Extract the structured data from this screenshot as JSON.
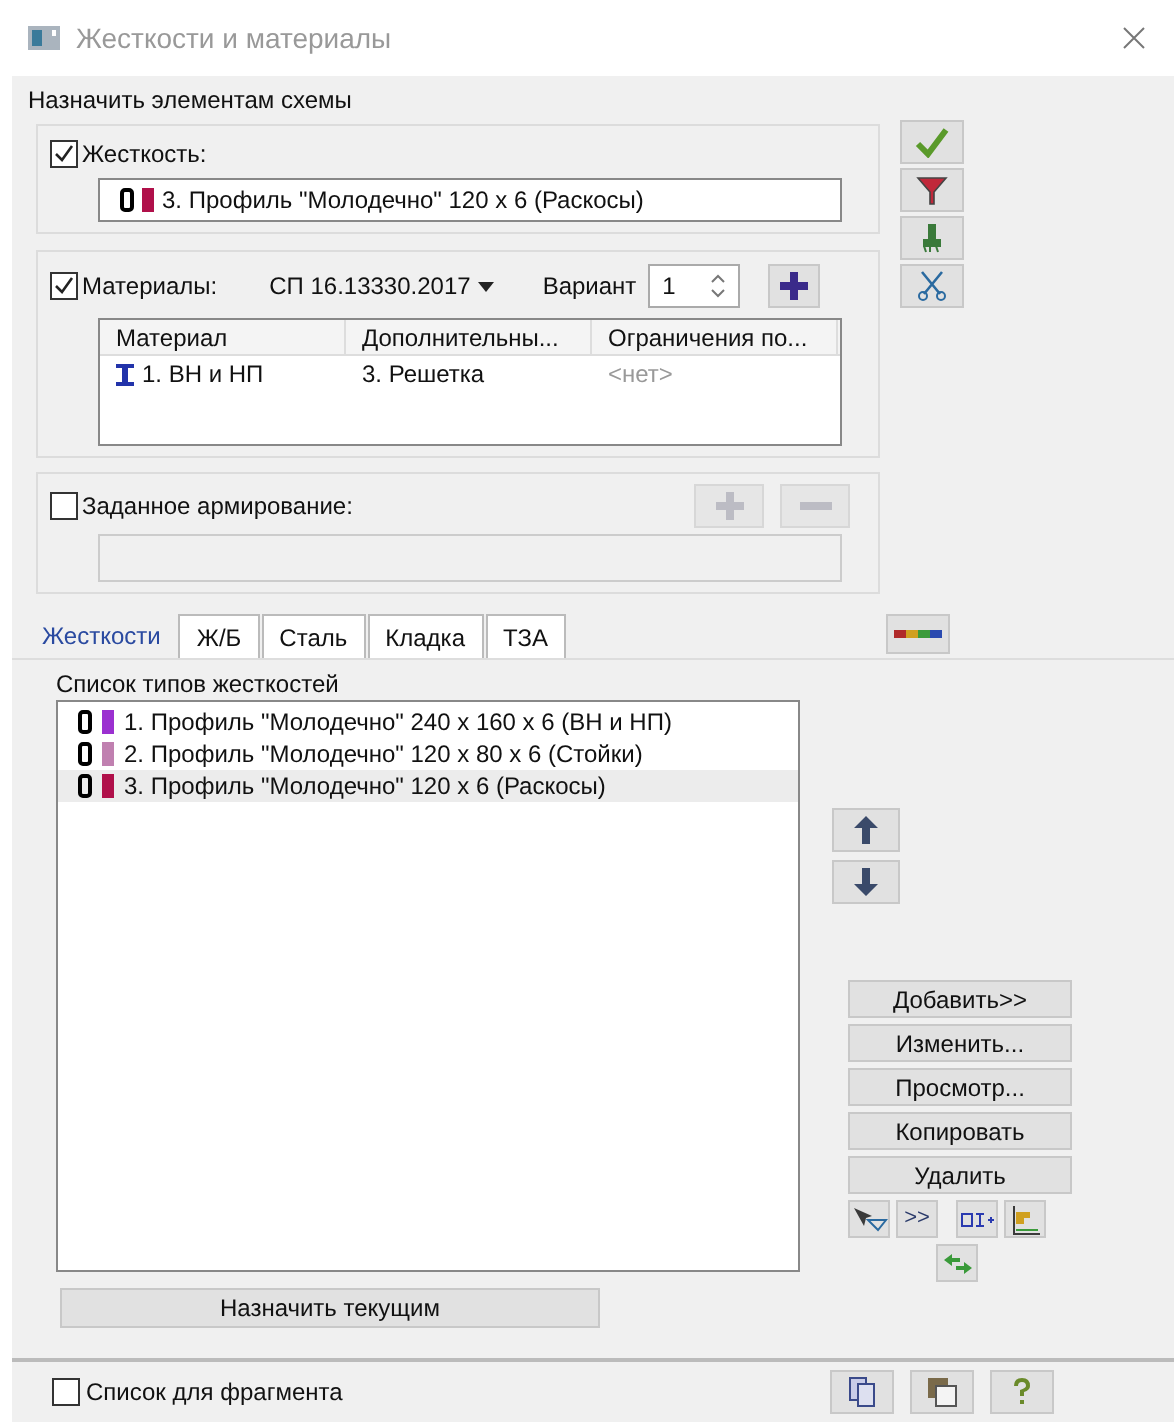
{
  "window": {
    "title": "Жесткости и материалы"
  },
  "assign_label": "Назначить элементам схемы",
  "stiffness": {
    "label": "Жесткость:",
    "checked": true,
    "value": "3. Профиль \"Молодечно\" 120 x 6 (Раскосы)",
    "color": "#b0104a"
  },
  "materials": {
    "label": "Материалы:",
    "checked": true,
    "standard": "СП 16.13330.2017",
    "variant_label": "Вариант",
    "variant": "1",
    "columns": [
      "Материал",
      "Дополнительны...",
      "Ограничения по..."
    ],
    "rows": [
      {
        "cells": [
          "1. ВН и НП",
          "3. Решетка",
          "<нет>"
        ]
      }
    ]
  },
  "reinforcement": {
    "label": "Заданное армирование:",
    "checked": false
  },
  "tabs": [
    {
      "label": "Жесткости",
      "selected": true
    },
    {
      "label": "Ж/Б",
      "selected": false
    },
    {
      "label": "Сталь",
      "selected": false
    },
    {
      "label": "Кладка",
      "selected": false
    },
    {
      "label": "ТЗА",
      "selected": false
    }
  ],
  "list": {
    "title": "Список типов жесткостей",
    "items": [
      {
        "text": "1. Профиль \"Молодечно\" 240 x 160 x 6 (ВН и НП)",
        "color": "#9b30d0",
        "selected": false
      },
      {
        "text": "2. Профиль \"Молодечно\" 120 x 80 x 6 (Стойки)",
        "color": "#c080b0",
        "selected": false
      },
      {
        "text": "3. Профиль \"Молодечно\" 120 x 6 (Раскосы)",
        "color": "#b0104a",
        "selected": true
      }
    ]
  },
  "action_buttons": [
    "Добавить>>",
    "Изменить...",
    "Просмотр...",
    "Копировать",
    "Удалить"
  ],
  "more_button": ">>",
  "assign_button": "Назначить текущим",
  "fragment": {
    "label": "Список для фрагмента",
    "checked": false
  }
}
